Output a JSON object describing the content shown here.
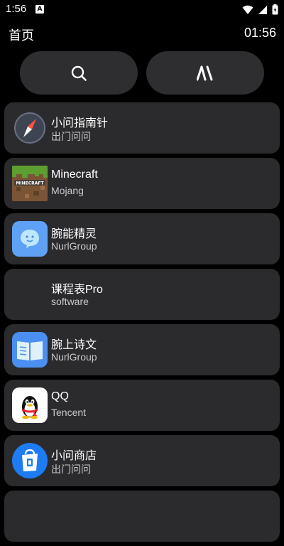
{
  "status": {
    "time": "1:56",
    "notif_letter": "A"
  },
  "header": {
    "title": "首页",
    "clock": "01:56"
  },
  "toolbar": {
    "search_icon": "search-icon",
    "apps_icon": "double-slash-icon"
  },
  "apps": [
    {
      "name": "小问指南针",
      "developer": "出门问问",
      "icon": "compass-icon"
    },
    {
      "name": "Minecraft",
      "developer": "Mojang",
      "icon": "minecraft-icon"
    },
    {
      "name": "腕能精灵",
      "developer": "NurlGroup",
      "icon": "chat-bubble-icon"
    },
    {
      "name": "课程表Pro",
      "developer": "software",
      "icon": ""
    },
    {
      "name": "腕上诗文",
      "developer": "NurlGroup",
      "icon": "open-book-icon"
    },
    {
      "name": "QQ",
      "developer": "Tencent",
      "icon": "qq-penguin-icon"
    },
    {
      "name": "小问商店",
      "developer": "出门问问",
      "icon": "shopping-bag-icon"
    }
  ]
}
